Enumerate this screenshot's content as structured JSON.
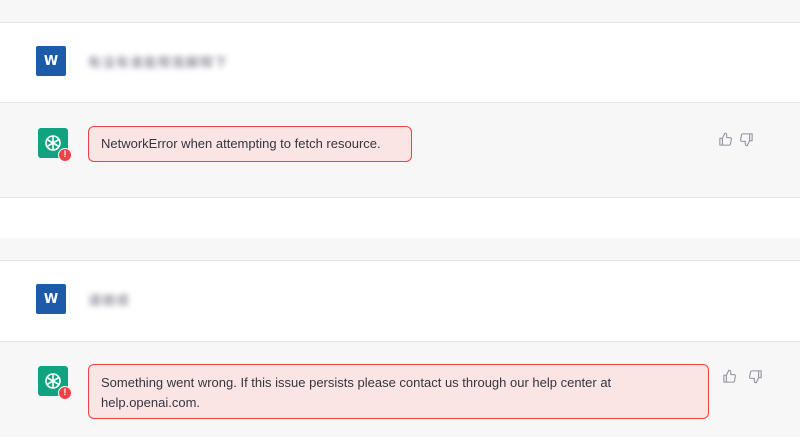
{
  "conversation": {
    "first": {
      "user_avatar_initial": "W",
      "user_message": "有没有谁能帮我解释下",
      "error_text": "NetworkError when attempting to fetch resource."
    },
    "second": {
      "user_avatar_initial": "W",
      "user_message": "请继续",
      "error_text_line1": "Something went wrong. If this issue persists please contact us through our help center at",
      "error_text_line2": "help.openai.com."
    }
  },
  "icons": {
    "assistant_avatar": "openai-logo-icon",
    "error_badge": "alert-icon",
    "thumbs_up": "thumbs-up-icon",
    "thumbs_down": "thumbs-down-icon"
  },
  "colors": {
    "user_avatar": "#1d5aa7",
    "assistant_avatar": "#10a37f",
    "error_border": "#ef4146",
    "error_background": "#fbe4e4",
    "band_gray": "#f7f7f8"
  }
}
